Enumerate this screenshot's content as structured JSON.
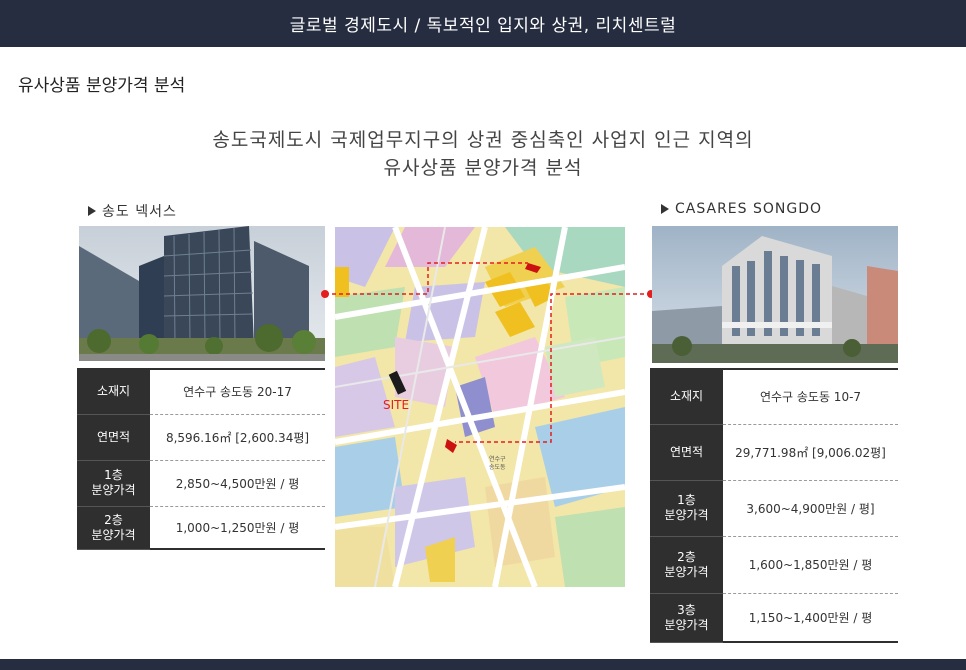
{
  "header": {
    "title": "글로벌 경제도시 / 독보적인 입지와 상권, 리치센트럴"
  },
  "section": {
    "title": "유사상품 분양가격 분석"
  },
  "headline": {
    "line1": "송도국제도시 국제업무지구의 상권 중심축인 사업지 인근 지역의",
    "line2": "유사상품 분양가격 분석"
  },
  "left": {
    "name": "송도 넥서스",
    "rows": [
      {
        "label": [
          "소재지"
        ],
        "value": "연수구 송도동 20-17"
      },
      {
        "label": [
          "연면적"
        ],
        "value": "8,596.16㎡ [2,600.34평]"
      },
      {
        "label": [
          "1층",
          "분양가격"
        ],
        "value": "2,850~4,500만원  / 평"
      },
      {
        "label": [
          "2층",
          "분양가격"
        ],
        "value": "1,000~1,250만원  / 평"
      }
    ]
  },
  "right": {
    "name": "CASARES SONGDO",
    "rows": [
      {
        "label": [
          "소재지"
        ],
        "value": "연수구 송도동 10-7"
      },
      {
        "label": [
          "연면적"
        ],
        "value": "29,771.98㎡ [9,006.02평]"
      },
      {
        "label": [
          "1층",
          "분양가격"
        ],
        "value": "3,600~4,900만원  / 평]"
      },
      {
        "label": [
          "2층",
          "분양가격"
        ],
        "value": "1,600~1,850만원  / 평"
      },
      {
        "label": [
          "3층",
          "분양가격"
        ],
        "value": "1,150~1,400만원  / 평"
      }
    ]
  },
  "map": {
    "site_label": "SITE",
    "district_label": [
      "연수구",
      "송도동"
    ],
    "colors": {
      "route": "#e41e1e",
      "background": "#f2e6a8",
      "road": "#ffffff"
    }
  }
}
